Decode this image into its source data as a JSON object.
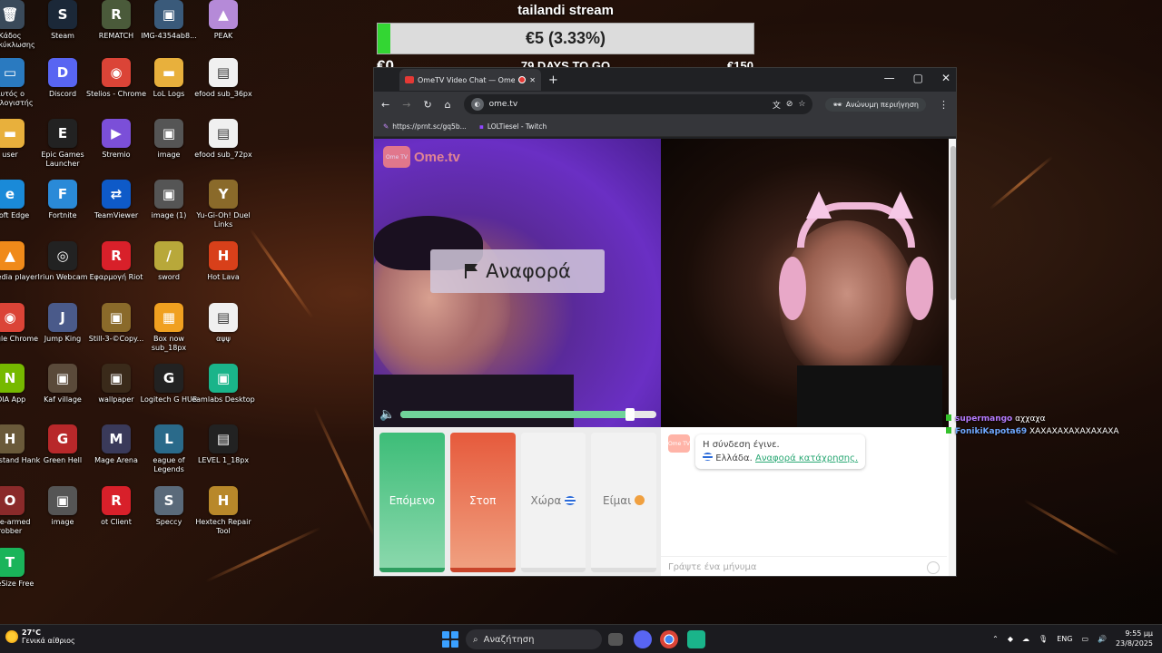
{
  "desktop": {
    "icons": [
      {
        "label": "Κάδος ανακύκλωσης",
        "color": "#3a4a5a",
        "glyph": "🗑"
      },
      {
        "label": "Steam",
        "color": "#1b2838",
        "glyph": "S"
      },
      {
        "label": "REMATCH",
        "color": "#4a5a3a",
        "glyph": "R"
      },
      {
        "label": "IMG-4354ab8...",
        "color": "#3a5a7a",
        "glyph": "▣"
      },
      {
        "label": "PEAK",
        "color": "#b58ad8",
        "glyph": "▲"
      },
      {
        "label": "Αυτός ο υπολογιστής",
        "color": "#2a7ac0",
        "glyph": "▭"
      },
      {
        "label": "Discord",
        "color": "#5865f2",
        "glyph": "D"
      },
      {
        "label": "Stelios - Chrome",
        "color": "#db4437",
        "glyph": "◉"
      },
      {
        "label": "LoL Logs",
        "color": "#e8b03c",
        "glyph": "▬"
      },
      {
        "label": "efood sub_36px",
        "color": "#f0f0f0",
        "glyph": "▤"
      },
      {
        "label": "user",
        "color": "#e8b03c",
        "glyph": "▬"
      },
      {
        "label": "Epic Games Launcher",
        "color": "#222",
        "glyph": "E"
      },
      {
        "label": "Stremio",
        "color": "#7b4fd8",
        "glyph": "▶"
      },
      {
        "label": "image",
        "color": "#555",
        "glyph": "▣"
      },
      {
        "label": "efood sub_72px",
        "color": "#f0f0f0",
        "glyph": "▤"
      },
      {
        "label": "osoft Edge",
        "color": "#1a8ad8",
        "glyph": "e"
      },
      {
        "label": "Fortnite",
        "color": "#2a8ad8",
        "glyph": "F"
      },
      {
        "label": "TeamViewer",
        "color": "#0e5ac8",
        "glyph": "⇄"
      },
      {
        "label": "image (1)",
        "color": "#555",
        "glyph": "▣"
      },
      {
        "label": "Yu-Gi-Oh! Duel Links",
        "color": "#8a6a2a",
        "glyph": "Y"
      },
      {
        "label": "C media player",
        "color": "#f08a1a",
        "glyph": "▲"
      },
      {
        "label": "Iriun Webcam",
        "color": "#222",
        "glyph": "◎"
      },
      {
        "label": "Εφαρμογή Riot",
        "color": "#d8202a",
        "glyph": "R"
      },
      {
        "label": "sword",
        "color": "#b8a83a",
        "glyph": "/"
      },
      {
        "label": "Hot Lava",
        "color": "#d8401a",
        "glyph": "H"
      },
      {
        "label": "Google Chrome",
        "color": "#db4437",
        "glyph": "◉"
      },
      {
        "label": "Jump King",
        "color": "#4a5a8a",
        "glyph": "J"
      },
      {
        "label": "Still-3-©Copy...",
        "color": "#8a6a2a",
        "glyph": "▣"
      },
      {
        "label": "Box now sub_18px",
        "color": "#f0a020",
        "glyph": "▦"
      },
      {
        "label": "αψψ",
        "color": "#f0f0f0",
        "glyph": "▤"
      },
      {
        "label": "IDIA App",
        "color": "#76b900",
        "glyph": "N"
      },
      {
        "label": "Kaf village",
        "color": "#5a4a3a",
        "glyph": "▣"
      },
      {
        "label": "wallpaper",
        "color": "#3a2a1a",
        "glyph": "▣"
      },
      {
        "label": "Logitech G HUB",
        "color": "#222",
        "glyph": "G"
      },
      {
        "label": "eamlabs Desktop",
        "color": "#1ab48a",
        "glyph": "▣"
      },
      {
        "label": "Handstand Hank",
        "color": "#6a5a3a",
        "glyph": "H"
      },
      {
        "label": "Green Hell",
        "color": "#b8282a",
        "glyph": "G"
      },
      {
        "label": "Mage Arena",
        "color": "#3a3a5a",
        "glyph": "M"
      },
      {
        "label": "eague of Legends",
        "color": "#2a6a8a",
        "glyph": "L"
      },
      {
        "label": "LEVEL 1_18px",
        "color": "#222",
        "glyph": "▤"
      },
      {
        "label": "One-armed robber",
        "color": "#8a2a2a",
        "glyph": "O"
      },
      {
        "label": "image",
        "color": "#555",
        "glyph": "▣"
      },
      {
        "label": "ot Client",
        "color": "#d8202a",
        "glyph": "R"
      },
      {
        "label": "Speccy",
        "color": "#5a6a7a",
        "glyph": "S"
      },
      {
        "label": "Hextech Repair Tool",
        "color": "#b8882a",
        "glyph": "H"
      },
      {
        "label": "TreeSize Free",
        "color": "#1ab45a",
        "glyph": "T"
      }
    ]
  },
  "stream": {
    "title": "tailandi stream",
    "goal_text": "€5 (3.33%)",
    "goal_fraction": 0.0333,
    "goal_min": "€0",
    "days_to_go": "79 DAYS TO GO",
    "goal_max": "€150"
  },
  "browser": {
    "tab_title": "OmeTV Video Chat — Ome",
    "new_tab": "+",
    "window": {
      "minimize": "—",
      "maximize": "▢",
      "close": "✕"
    },
    "url": "ome.tv",
    "incognito_label": "Ανώνυμη περιήγηση",
    "bookmarks": [
      "https://prnt.sc/gq5b...",
      "LOLTiesel - Twitch"
    ]
  },
  "ometv": {
    "logo_text": "Ome.tv",
    "logo_badge": "Ome TV",
    "report_label": "Αναφορά",
    "volume_fraction": 0.9,
    "buttons": {
      "next": "Επόμενο",
      "stop": "Στοπ",
      "country": "Χώρα",
      "gender": "Είμαι"
    },
    "chat": {
      "line1": "Η σύνδεση έγινε.",
      "country": "Ελλάδα.",
      "report_link": "Αναφορά κατάχρησης.",
      "placeholder": "Γράψτε ένα μήνυμα"
    }
  },
  "twitch_chat": [
    {
      "user": "supermango",
      "message": "αχχαχα"
    },
    {
      "user": "FonikiKapota69",
      "message": "ΧΑΧΑΧΑΧΑΧΑΧΑΧΑΧΑ"
    }
  ],
  "taskbar": {
    "temperature": "27°C",
    "weather": "Γενικά αίθριος",
    "search_label": "Αναζήτηση",
    "language": "ENG",
    "time": "9:55 μμ",
    "date": "23/8/2025"
  }
}
